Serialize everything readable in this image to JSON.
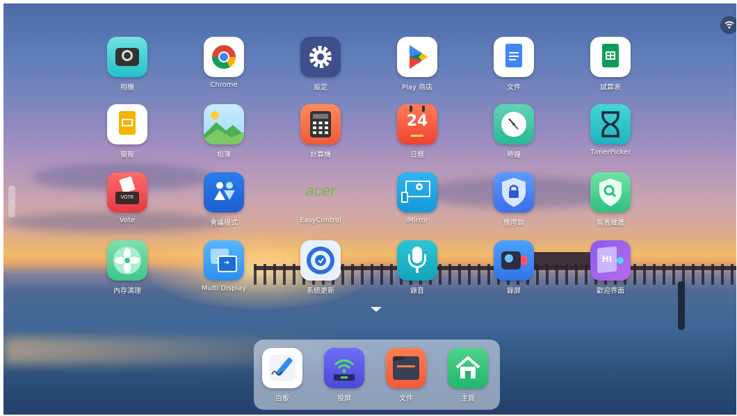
{
  "status": {
    "wifi_icon": "wifi-icon"
  },
  "apps": [
    {
      "id": "camera",
      "label": "相機"
    },
    {
      "id": "chrome",
      "label": "Chrome"
    },
    {
      "id": "settings",
      "label": "設定"
    },
    {
      "id": "play-store",
      "label": "Play 商店"
    },
    {
      "id": "docs",
      "label": "文件"
    },
    {
      "id": "sheets",
      "label": "試算表"
    },
    {
      "id": "slides",
      "label": "簡報"
    },
    {
      "id": "gallery",
      "label": "相簿"
    },
    {
      "id": "calculator",
      "label": "計算機"
    },
    {
      "id": "calendar",
      "label": "日曆",
      "day": "24"
    },
    {
      "id": "clock",
      "label": "時鐘"
    },
    {
      "id": "timerpicker",
      "label": "TimerPicker"
    },
    {
      "id": "vote",
      "label": "Vote",
      "badge": "VOTE"
    },
    {
      "id": "meeting-mode",
      "label": "會議模式"
    },
    {
      "id": "easycontrol",
      "label": "EasyControl",
      "logo_text": "acer"
    },
    {
      "id": "imirror",
      "label": "iMirror"
    },
    {
      "id": "app-lock",
      "label": "應用鎖"
    },
    {
      "id": "device-maintenance",
      "label": "裝置維護"
    },
    {
      "id": "memory-clean",
      "label": "內存清理"
    },
    {
      "id": "multi-display",
      "label": "Multi Display"
    },
    {
      "id": "system-update",
      "label": "系統更新"
    },
    {
      "id": "recorder",
      "label": "錄音"
    },
    {
      "id": "screen-record",
      "label": "錄屏"
    },
    {
      "id": "welcome",
      "label": "歡迎界面",
      "badge": "HI"
    }
  ],
  "dock": [
    {
      "id": "whiteboard",
      "label": "白板"
    },
    {
      "id": "cast",
      "label": "投屏"
    },
    {
      "id": "files",
      "label": "文件"
    },
    {
      "id": "home",
      "label": "主頁"
    }
  ]
}
